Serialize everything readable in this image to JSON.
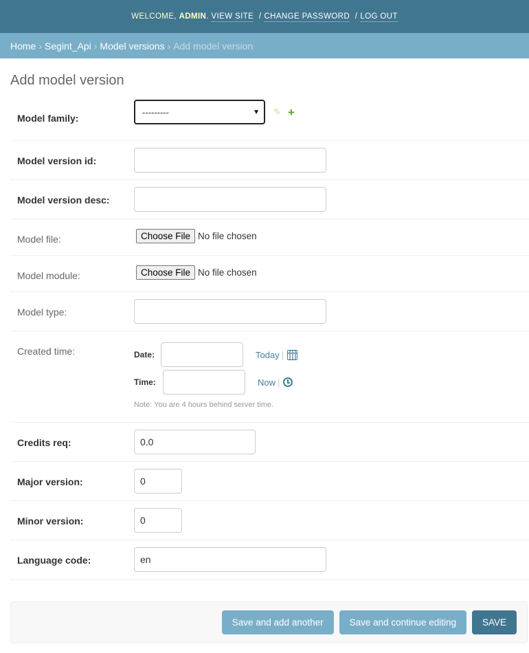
{
  "header": {
    "welcome": "Welcome,",
    "user": "admin",
    "dot": ".",
    "view_site": "View site",
    "change_password": "Change password",
    "log_out": "Log out",
    "sep": "/"
  },
  "breadcrumbs": {
    "items": [
      "Home",
      "Segint_Api",
      "Model versions"
    ],
    "current": "Add model version",
    "separator": "›"
  },
  "page": {
    "title": "Add model version"
  },
  "form": {
    "model_family": {
      "label": "Model family:",
      "value": "---------"
    },
    "model_version_id": {
      "label": "Model version id:",
      "value": ""
    },
    "model_version_desc": {
      "label": "Model version desc:",
      "value": ""
    },
    "model_file": {
      "label": "Model file:",
      "button": "Choose File",
      "status": "No file chosen"
    },
    "model_module": {
      "label": "Model module:",
      "button": "Choose File",
      "status": "No file chosen"
    },
    "model_type": {
      "label": "Model type:",
      "value": ""
    },
    "created_time": {
      "label": "Created time:",
      "date_label": "Date:",
      "date_value": "",
      "today": "Today",
      "time_label": "Time:",
      "time_value": "",
      "now": "Now",
      "bar": "|",
      "note": "Note: You are 4 hours behind server time."
    },
    "credits_req": {
      "label": "Credits req:",
      "value": "0.0"
    },
    "major_version": {
      "label": "Major version:",
      "value": "0"
    },
    "minor_version": {
      "label": "Minor version:",
      "value": "0"
    },
    "language_code": {
      "label": "Language code:",
      "value": "en"
    }
  },
  "submit": {
    "save_add_another": "Save and add another",
    "save_continue": "Save and continue editing",
    "save": "Save"
  },
  "icons": {
    "change": "pencil-icon",
    "add": "plus-icon",
    "calendar": "calendar-icon",
    "clock": "clock-icon",
    "select": "chevron-down-icon"
  },
  "colors": {
    "header_bg": "#417690",
    "breadcrumbs_bg": "#79aec8",
    "link": "#447e9b",
    "add_green": "#5fa225",
    "welcome_yellow": "#ffffcc"
  }
}
